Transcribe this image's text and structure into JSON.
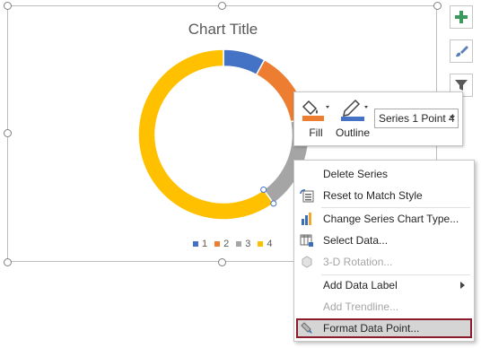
{
  "chart": {
    "title": "Chart Title",
    "legend": [
      {
        "label": "1",
        "color": "#4472c4"
      },
      {
        "label": "2",
        "color": "#ed7d31"
      },
      {
        "label": "3",
        "color": "#a5a5a5"
      },
      {
        "label": "4",
        "color": "#ffc000"
      }
    ]
  },
  "side_buttons": [
    {
      "icon": "plus-icon"
    },
    {
      "icon": "brush-icon"
    },
    {
      "icon": "filter-icon"
    }
  ],
  "mini_toolbar": {
    "fill_label": "Fill",
    "outline_label": "Outline",
    "series_select_value": "Series 1 Point 4"
  },
  "context_menu": {
    "items": [
      {
        "label": "Delete Series",
        "icon": "delete-series-icon",
        "enabled": true
      },
      {
        "label": "Reset to Match Style",
        "icon": "reset-style-icon",
        "enabled": true
      },
      {
        "label": "Change Series Chart Type...",
        "icon": "bar-chart-icon",
        "enabled": true
      },
      {
        "label": "Select Data...",
        "icon": "select-data-icon",
        "enabled": true
      },
      {
        "label": "3-D Rotation...",
        "icon": "cube-icon",
        "enabled": false
      },
      {
        "label": "Add Data Label",
        "icon": "",
        "enabled": true,
        "submenu": true
      },
      {
        "label": "Add Trendline...",
        "icon": "",
        "enabled": false
      },
      {
        "label": "Format Data Point...",
        "icon": "format-paint-icon",
        "enabled": true,
        "highlighted": true
      }
    ]
  },
  "chart_data": {
    "type": "pie",
    "categories": [
      "1",
      "2",
      "3",
      "4"
    ],
    "values": [
      8,
      14,
      18,
      60
    ],
    "title": "Chart Title",
    "legend_position": "bottom"
  }
}
